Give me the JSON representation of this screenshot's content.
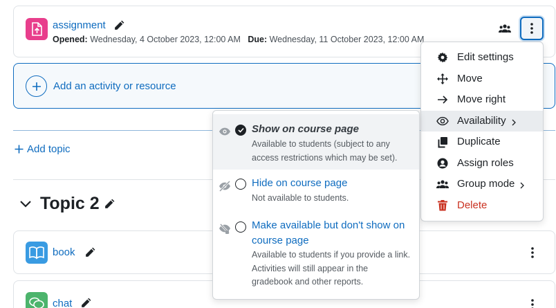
{
  "assignment": {
    "title": "assignment",
    "opened_label": "Opened:",
    "opened_value": "Wednesday, 4 October 2023, 12:00 AM",
    "due_label": "Due:",
    "due_value": "Wednesday, 11 October 2023, 12:00 AM"
  },
  "add_activity": {
    "label": "Add an activity or resource"
  },
  "add_topic": {
    "label": "Add topic"
  },
  "topic2": {
    "title": "Topic 2"
  },
  "book": {
    "title": "book"
  },
  "chat": {
    "title": "chat"
  },
  "action_menu": {
    "items": [
      {
        "label": "Edit settings",
        "icon": "gear-icon"
      },
      {
        "label": "Move",
        "icon": "move-arrows-icon"
      },
      {
        "label": "Move right",
        "icon": "arrow-right-icon"
      },
      {
        "label": "Availability",
        "icon": "eye-icon"
      },
      {
        "label": "Duplicate",
        "icon": "copy-icon"
      },
      {
        "label": "Assign roles",
        "icon": "user-circle-icon"
      },
      {
        "label": "Group mode",
        "icon": "users-icon"
      },
      {
        "label": "Delete",
        "icon": "trash-icon"
      }
    ]
  },
  "availability_menu": {
    "options": [
      {
        "title": "Show on course page",
        "desc": "Available to students (subject to any access restrictions which may be set).",
        "selected": true
      },
      {
        "title": "Hide on course page",
        "desc": "Not available to students.",
        "selected": false
      },
      {
        "title": "Make available but don't show on course page",
        "desc": "Available to students if you provide a link. Activities will still appear in the gradebook and other reports.",
        "selected": false
      }
    ]
  },
  "colors": {
    "link": "#0f6cbf",
    "assignment_icon_bg": "#e83e8c",
    "book_icon_bg": "#399be2",
    "chat_icon_bg": "#4cb46c",
    "danger": "#ca3120"
  }
}
